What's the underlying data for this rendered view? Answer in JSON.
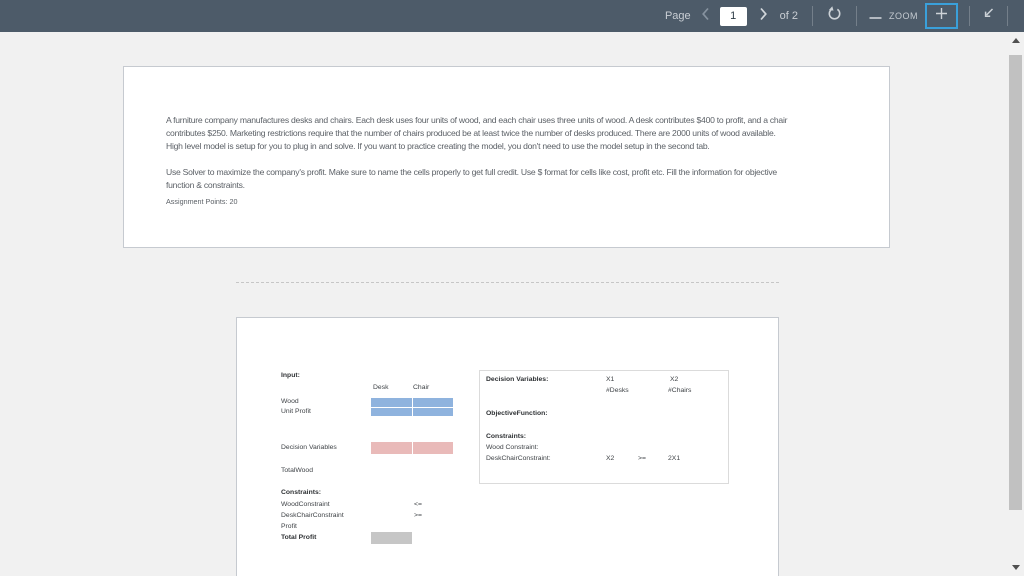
{
  "toolbar": {
    "page_label": "Page",
    "page_value": "1",
    "of_label": "of 2",
    "zoom_label": "ZOOM",
    "icons": [
      "chevron-left-icon",
      "chevron-right-icon",
      "rotate-icon",
      "zoom-out-minus-icon",
      "zoom-in-plus-icon",
      "exit-fullscreen-icon"
    ]
  },
  "page1": {
    "para1_lines": [
      "A furniture company manufactures desks and chairs. Each desk uses four units of wood, and each chair uses three units of wood. A desk contributes $400 to profit, and a chair",
      "contributes $250. Marketing restrictions require that the number of chairs produced be at least twice the number of desks produced. There are 2000 units of wood available.",
      "High level model is setup for you to plug in and solve.   If you want to practice creating the model, you don't need to use the model setup in the second tab."
    ],
    "para2_lines": [
      "Use Solver to maximize the company's profit. Make sure to name the cells properly to get full credit. Use $ format for cells like cost, profit etc.  Fill the information for objective",
      "function & constraints."
    ],
    "points": "Assignment Points: 20"
  },
  "page2": {
    "input_label": "Input:",
    "col_desk": "Desk",
    "col_chair": "Chair",
    "row_wood": "Wood",
    "row_unit_profit": "Unit Profit",
    "decision_variables_label": "Decision Variables",
    "total_wood_label": "TotalWood",
    "constraints_label": "Constraints:",
    "wood_constraint_label": "WoodConstraint",
    "wood_constraint_op": "<=",
    "desk_chair_constraint_label": "DeskChairConstraint",
    "desk_chair_constraint_op": ">=",
    "profit_label": "Profit",
    "total_profit_label": "Total Profit",
    "model_box": {
      "decision_variables_label": "Decision Variables:",
      "x1": "X1",
      "x2": "X2",
      "desks": "#Desks",
      "chairs": "#Chairs",
      "objective_function_label": "ObjectiveFunction:",
      "constraints_label": "Constraints:",
      "wood_constraint_label": "Wood Constraint:",
      "desk_chair_constraint_label": "DeskChairConstraint:",
      "dc_lhs": "X2",
      "dc_op": ">=",
      "dc_rhs": "2X1"
    }
  },
  "colors": {
    "toolbar_bg": "#4d5b69",
    "accent_blue": "#3aa0da",
    "canvas_bg": "#f1f1f1",
    "page_bg": "#ffffff",
    "cell_blue": "#8fb3de",
    "cell_pink": "#e9bab9",
    "cell_gray": "#c6c6c6",
    "scrollbar_thumb": "#c1c1c1"
  }
}
